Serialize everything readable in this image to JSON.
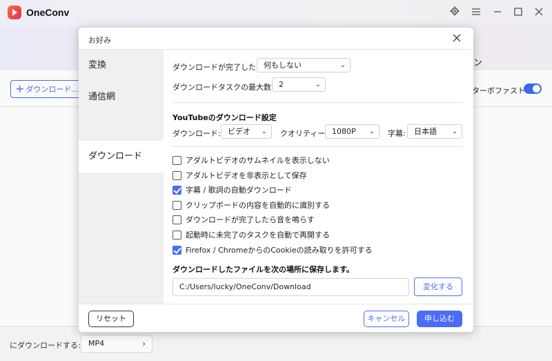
{
  "app": {
    "name": "OneConv",
    "tab_label": "ン",
    "download_button": "ダウンロード...",
    "turbo_label": "ターボファスト",
    "turbo_on": true,
    "format_label": "にダウンロードする:",
    "format_value": "MP4"
  },
  "icons": {
    "settings": "gear-icon",
    "menu": "hamburger-icon",
    "minimize": "minimize-icon",
    "maximize": "maximize-icon",
    "close": "close-icon"
  },
  "dialog": {
    "title": "お好み",
    "sidebar": [
      {
        "label": "変換",
        "active": false
      },
      {
        "label": "通信網",
        "active": false
      },
      {
        "label": "ダウンロード",
        "active": true
      }
    ],
    "after_download_label": "ダウンロードが完了したら",
    "after_download_value": "何もしない",
    "max_tasks_label": "ダウンロードタスクの最大数:",
    "max_tasks_value": "2",
    "youtube_section_title": "YouTubeのダウンロード設定",
    "youtube_download_label": "ダウンロード:",
    "youtube_download_value": "ビデオ",
    "quality_label": "クオリティー:",
    "quality_value": "1080P",
    "subtitle_label": "字幕:",
    "subtitle_value": "日本語",
    "checkboxes": [
      {
        "label": "アダルトビデオのサムネイルを表示しない",
        "checked": false
      },
      {
        "label": "アダルトビデオを非表示として保存",
        "checked": false
      },
      {
        "label": "字幕 / 歌詞の自動ダウンロード",
        "checked": true
      },
      {
        "label": "クリップボードの内容を自動的に識別する",
        "checked": false
      },
      {
        "label": "ダウンロードが完了したら音を鳴らす",
        "checked": false
      },
      {
        "label": "起動時に未完了のタスクを自動で再開する",
        "checked": false
      },
      {
        "label": "Firefox / ChromeからのCookieの読み取りを許可する",
        "checked": true
      }
    ],
    "save_location_title": "ダウンロードしたファイルを次の場所に保存します。",
    "save_path": "C:/Users/lucky/OneConv/Download",
    "change_button": "変化する",
    "reset_button": "リセット",
    "cancel_button": "キャンセル",
    "apply_button": "申し込む"
  },
  "colors": {
    "accent": "#4a6cf7",
    "sidebar_bg": "#f0f0f0"
  }
}
